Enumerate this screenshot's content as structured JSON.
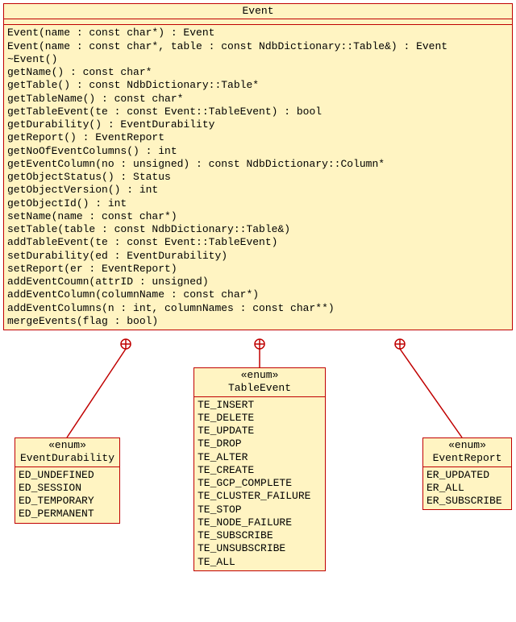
{
  "event_class": {
    "name": "Event",
    "operations": [
      "Event(name : const char*) : Event",
      "Event(name : const char*, table : const NdbDictionary::Table&) : Event",
      "~Event()",
      "getName() : const char*",
      "getTable() : const NdbDictionary::Table*",
      "getTableName() : const char*",
      "getTableEvent(te : const Event::TableEvent) : bool",
      "getDurability() : EventDurability",
      "getReport() : EventReport",
      "getNoOfEventColumns() : int",
      "getEventColumn(no : unsigned) : const NdbDictionary::Column*",
      "getObjectStatus() : Status",
      "getObjectVersion() : int",
      "getObjectId() : int",
      "setName(name : const char*)",
      "setTable(table : const NdbDictionary::Table&)",
      "addTableEvent(te : const Event::TableEvent)",
      "setDurability(ed : EventDurability)",
      "setReport(er : EventReport)",
      "addEventCoumn(attrID : unsigned)",
      "addEventColumn(columnName : const char*)",
      "addEventColumns(n : int, columnNames : const char**)",
      "mergeEvents(flag : bool)"
    ]
  },
  "enum_stereotype": "«enum»",
  "event_durability": {
    "name": "EventDurability",
    "values": [
      "ED_UNDEFINED",
      "ED_SESSION",
      "ED_TEMPORARY",
      "ED_PERMANENT"
    ]
  },
  "table_event": {
    "name": "TableEvent",
    "values": [
      "TE_INSERT",
      "TE_DELETE",
      "TE_UPDATE",
      "TE_DROP",
      "TE_ALTER",
      "TE_CREATE",
      "TE_GCP_COMPLETE",
      "TE_CLUSTER_FAILURE",
      "TE_STOP",
      "TE_NODE_FAILURE",
      "TE_SUBSCRIBE",
      "TE_UNSUBSCRIBE",
      "TE_ALL"
    ]
  },
  "event_report": {
    "name": "EventReport",
    "values": [
      "ER_UPDATED",
      "ER_ALL",
      "ER_SUBSCRIBE"
    ]
  }
}
